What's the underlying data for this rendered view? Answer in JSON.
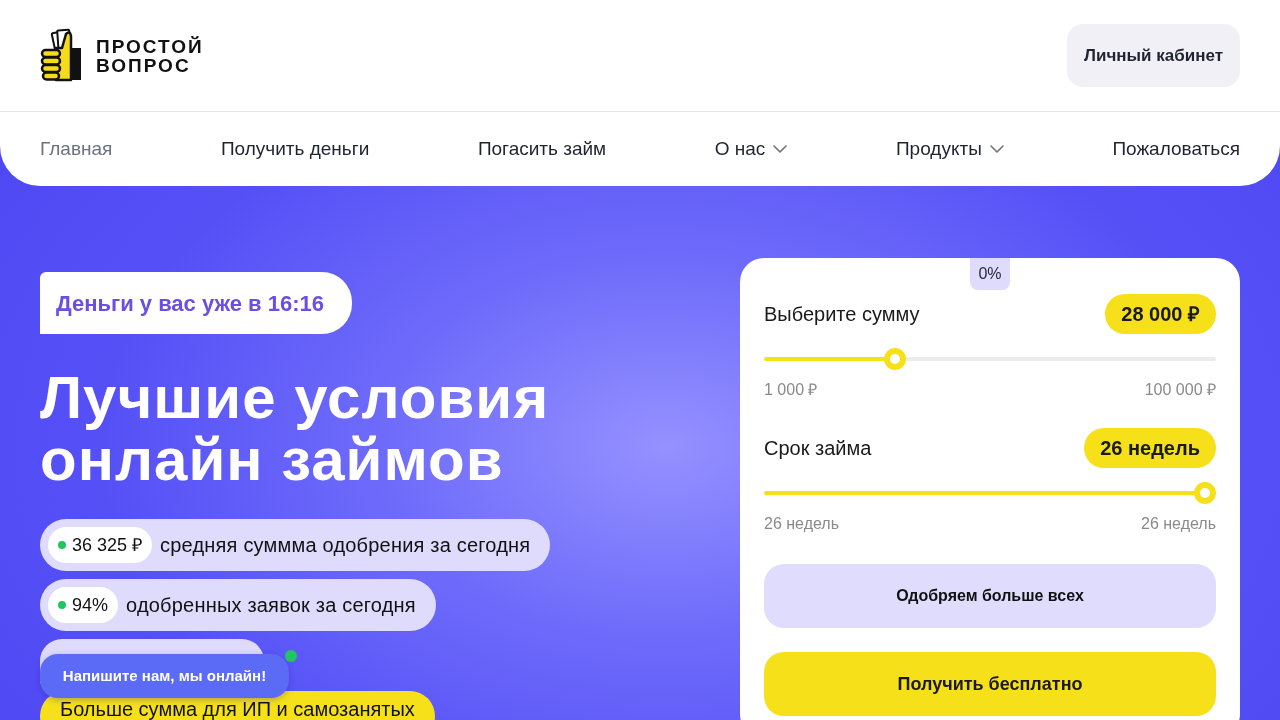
{
  "header": {
    "logo": {
      "lines": [
        "ПРОСТОЙ",
        "ВОПРОС"
      ]
    },
    "account_button": "Личный кабинет"
  },
  "nav": [
    {
      "label": "Главная",
      "selected": true,
      "dropdown": false
    },
    {
      "label": "Получить деньги",
      "selected": false,
      "dropdown": false
    },
    {
      "label": "Погасить займ",
      "selected": false,
      "dropdown": false
    },
    {
      "label": "О нас",
      "selected": false,
      "dropdown": true
    },
    {
      "label": "Продукты",
      "selected": false,
      "dropdown": true
    },
    {
      "label": "Пожаловаться",
      "selected": false,
      "dropdown": false
    }
  ],
  "hero": {
    "badge": "Деньги у вас уже в 16:16",
    "title": "Лучшие условия онлайн займов",
    "stats": [
      {
        "value": "36 325 ₽",
        "label": "средняя суммма одобрения за сегодня"
      },
      {
        "value": "94%",
        "label": "одобренных заявок за сегодня"
      }
    ],
    "promo": "Больше сумма для ИП и самозанятых"
  },
  "chat_button": {
    "label": "Напишите нам, мы онлайн!",
    "online": true
  },
  "calculator": {
    "rate_tab": "0%",
    "sliders": [
      {
        "label": "Выберите сумму",
        "value": "28 000 ₽",
        "level": 0.28,
        "min": "1 000 ₽",
        "max": "100 000 ₽"
      },
      {
        "label": "Срок займа",
        "value": "26 недель",
        "level": 1,
        "min": "26 недель",
        "max": "26 недель"
      }
    ],
    "buttons": [
      {
        "label": "Одобряем больше всех",
        "kind": "secondary"
      },
      {
        "label": "Получить бесплатно",
        "kind": "primary"
      }
    ]
  }
}
